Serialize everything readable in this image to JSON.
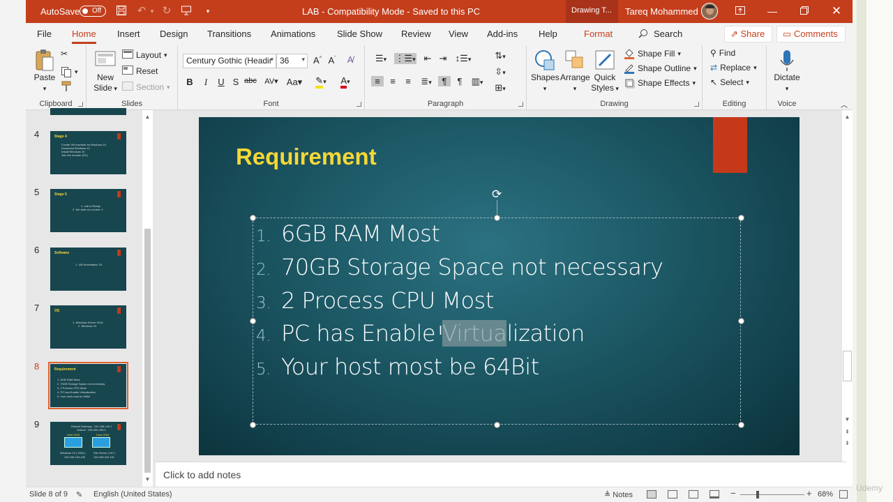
{
  "titlebar": {
    "autosave_label": "AutoSave",
    "autosave_state": "Off",
    "doc_title": "LAB  -  Compatibility Mode  -  Saved to this PC",
    "context_tab": "Drawing T...",
    "user": "Tareq Mohammed"
  },
  "tabs": [
    "File",
    "Home",
    "Insert",
    "Design",
    "Transitions",
    "Animations",
    "Slide Show",
    "Review",
    "View",
    "Add-ins",
    "Help",
    "Format"
  ],
  "search_label": "Search",
  "share_label": "Share",
  "comments_label": "Comments",
  "ribbon": {
    "clipboard": {
      "paste": "Paste",
      "label": "Clipboard"
    },
    "slides": {
      "new_slide": "New",
      "new_slide2": "Slide",
      "layout": "Layout",
      "reset": "Reset",
      "section": "Section",
      "label": "Slides"
    },
    "font": {
      "name": "Century Gothic (Headir",
      "size": "36",
      "label": "Font"
    },
    "paragraph": {
      "label": "Paragraph"
    },
    "drawing": {
      "shapes": "Shapes",
      "arrange": "Arrange",
      "quick_styles": "Quick",
      "quick_styles2": "Styles",
      "fill": "Shape Fill",
      "outline": "Shape Outline",
      "effects": "Shape Effects",
      "label": "Drawing"
    },
    "editing": {
      "find": "Find",
      "replace": "Replace",
      "select": "Select",
      "label": "Editing"
    },
    "voice": {
      "dictate": "Dictate",
      "label": "Voice"
    }
  },
  "slides": [
    {
      "num": "4",
      "title": "Stage 4",
      "lines": [
        "Create VM machine for Windows 10",
        "Download Windows 10",
        "Install Windows 10",
        "Join the domain (DC)"
      ]
    },
    {
      "num": "5",
      "title": "Stage 5",
      "lines": [
        "1. Lab is Ready",
        "2. We start our course ☺"
      ]
    },
    {
      "num": "6",
      "title": "Software",
      "lines": [
        "1. VM Workstation 15"
      ]
    },
    {
      "num": "7",
      "title": "OS",
      "lines": [
        "1. Windows Server 2016",
        "2. Windows 10"
      ]
    },
    {
      "num": "8",
      "title": "Requirement",
      "lines": [
        "1. 6GB RAM Most",
        "2. 70GB Storage Space not necessary",
        "3. 2 Process CPU Most",
        "4. PC has Enable Virtualization",
        "5. Your host most be 64Bit"
      ]
    },
    {
      "num": "9",
      "title": "",
      "lines": [
        "Default Gateway : 192.168.100.1",
        "Subnet : 255.255.255.0",
        "Host 2016",
        "Host 2016",
        "Windows 10 ( 2016 )",
        "192.168.100.100",
        "Win Server ( DC )",
        "192.168.100.101"
      ]
    }
  ],
  "slide": {
    "title": "Requirement",
    "items": [
      {
        "n": "1.",
        "text": "6GB RAM Most"
      },
      {
        "n": "2.",
        "text": "70GB Storage Space not necessary"
      },
      {
        "n": "3.",
        "text": "2 Process CPU Most"
      },
      {
        "n": "4.",
        "pre": "PC has Enable ",
        "hl": "Virtua",
        "post": "lization"
      },
      {
        "n": "5.",
        "text": "Your host most be 64Bit"
      }
    ]
  },
  "notes_placeholder": "Click to add notes",
  "status": {
    "slide": "Slide 8 of 9",
    "language": "English (United States)",
    "notes": "Notes",
    "zoom": "68%"
  },
  "watermark": "Udemy",
  "colors": {
    "accent": "#c43e1c",
    "slide_bg": "#1d5966",
    "title": "#f7d736",
    "thumb_sel": "#e0632f"
  }
}
